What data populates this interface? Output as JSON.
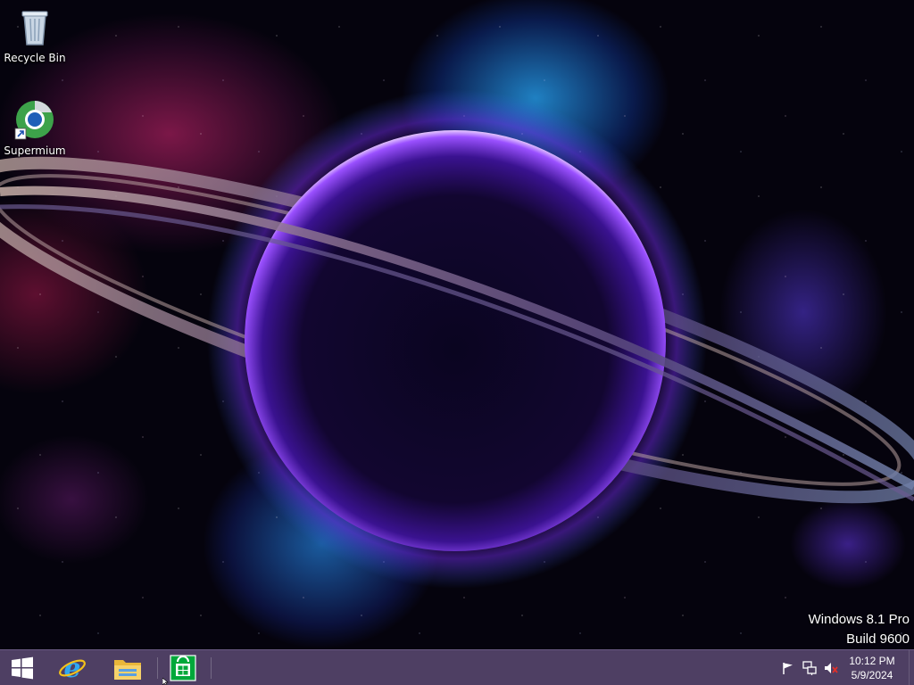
{
  "desktop": {
    "icons": [
      {
        "label": "Recycle Bin",
        "icon": "recycle-bin-icon"
      },
      {
        "label": "Supermium",
        "icon": "supermium-browser-icon"
      }
    ],
    "watermark": {
      "line1": "Windows 8.1 Pro",
      "line2": "Build 9600"
    }
  },
  "taskbar": {
    "color": "#4e3f63",
    "pinned": [
      {
        "icon": "windows-start-icon"
      },
      {
        "icon": "internet-explorer-icon"
      },
      {
        "icon": "file-explorer-icon"
      },
      {
        "icon": "windows-store-icon"
      }
    ],
    "tray": {
      "icons": [
        "action-center-flag-icon",
        "network-icon",
        "volume-muted-icon"
      ],
      "time": "10:12 PM",
      "date": "5/9/2024"
    }
  },
  "colors": {
    "planet_glow": "#8a3cff",
    "nebula_pink": "#d0307a",
    "nebula_blue": "#28a8ff",
    "store_green": "#00a83a"
  }
}
